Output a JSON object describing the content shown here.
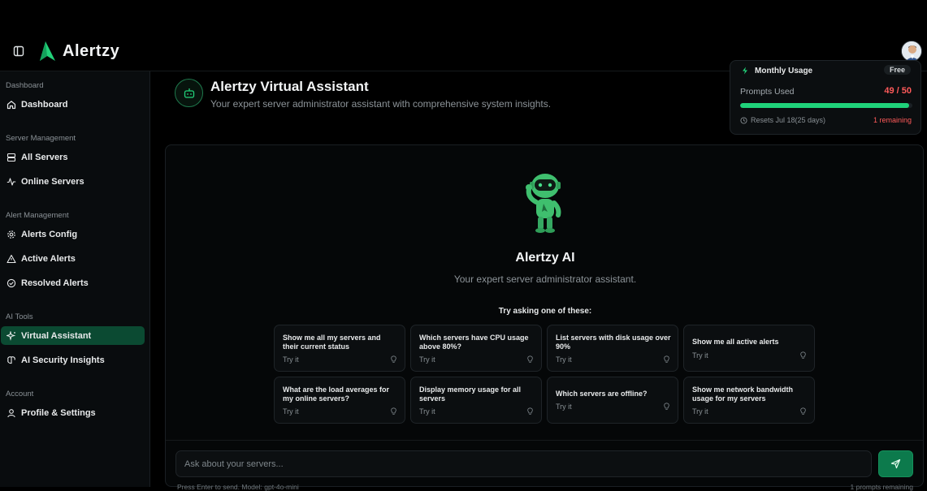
{
  "app": {
    "brand": "Alertzy"
  },
  "sidebar": {
    "sections": [
      {
        "title": "Dashboard",
        "items": [
          {
            "label": "Dashboard",
            "icon": "home-icon"
          }
        ]
      },
      {
        "title": "Server Management",
        "items": [
          {
            "label": "All Servers",
            "icon": "server-icon"
          },
          {
            "label": "Online Servers",
            "icon": "activity-icon"
          }
        ]
      },
      {
        "title": "Alert Management",
        "items": [
          {
            "label": "Alerts Config",
            "icon": "gear-icon"
          },
          {
            "label": "Active Alerts",
            "icon": "warning-triangle-icon"
          },
          {
            "label": "Resolved Alerts",
            "icon": "check-circle-icon"
          }
        ]
      },
      {
        "title": "AI Tools",
        "items": [
          {
            "label": "Virtual Assistant",
            "icon": "sparkles-icon",
            "active": true
          },
          {
            "label": "AI Security Insights",
            "icon": "brain-icon"
          }
        ]
      },
      {
        "title": "Account",
        "items": [
          {
            "label": "Profile & Settings",
            "icon": "user-icon"
          }
        ]
      }
    ]
  },
  "header": {
    "icon": "robot-icon",
    "title": "Alertzy Virtual Assistant",
    "subtitle": "Your expert server administrator assistant with comprehensive system insights."
  },
  "usage": {
    "title": "Monthly Usage",
    "plan": "Free",
    "label": "Prompts Used",
    "count": "49 / 50",
    "progress_fraction": 0.98,
    "reset": "Resets Jul 18(25 days)",
    "remaining": "1 remaining"
  },
  "chat": {
    "ai_title": "Alertzy AI",
    "ai_subtitle": "Your expert server administrator assistant.",
    "try_heading": "Try asking one of these:",
    "suggestions": [
      {
        "question": "Show me all my servers and their current status",
        "action": "Try it"
      },
      {
        "question": "Which servers have CPU usage above 80%?",
        "action": "Try it"
      },
      {
        "question": "List servers with disk usage over 90%",
        "action": "Try it"
      },
      {
        "question": "Show me all active alerts",
        "action": "Try it"
      },
      {
        "question": "What are the load averages for my online servers?",
        "action": "Try it"
      },
      {
        "question": "Display memory usage for all servers",
        "action": "Try it"
      },
      {
        "question": "Which servers are offline?",
        "action": "Try it"
      },
      {
        "question": "Show me network bandwidth usage for my servers",
        "action": "Try it"
      }
    ],
    "input_placeholder": "Ask about your servers...",
    "hint_left": "Press Enter to send. Model: gpt-4o-mini",
    "hint_right": "1 prompts remaining"
  },
  "colors": {
    "accent": "#1fd27a",
    "active_nav": "#0b4a32",
    "warning": "#ff5a5a"
  }
}
